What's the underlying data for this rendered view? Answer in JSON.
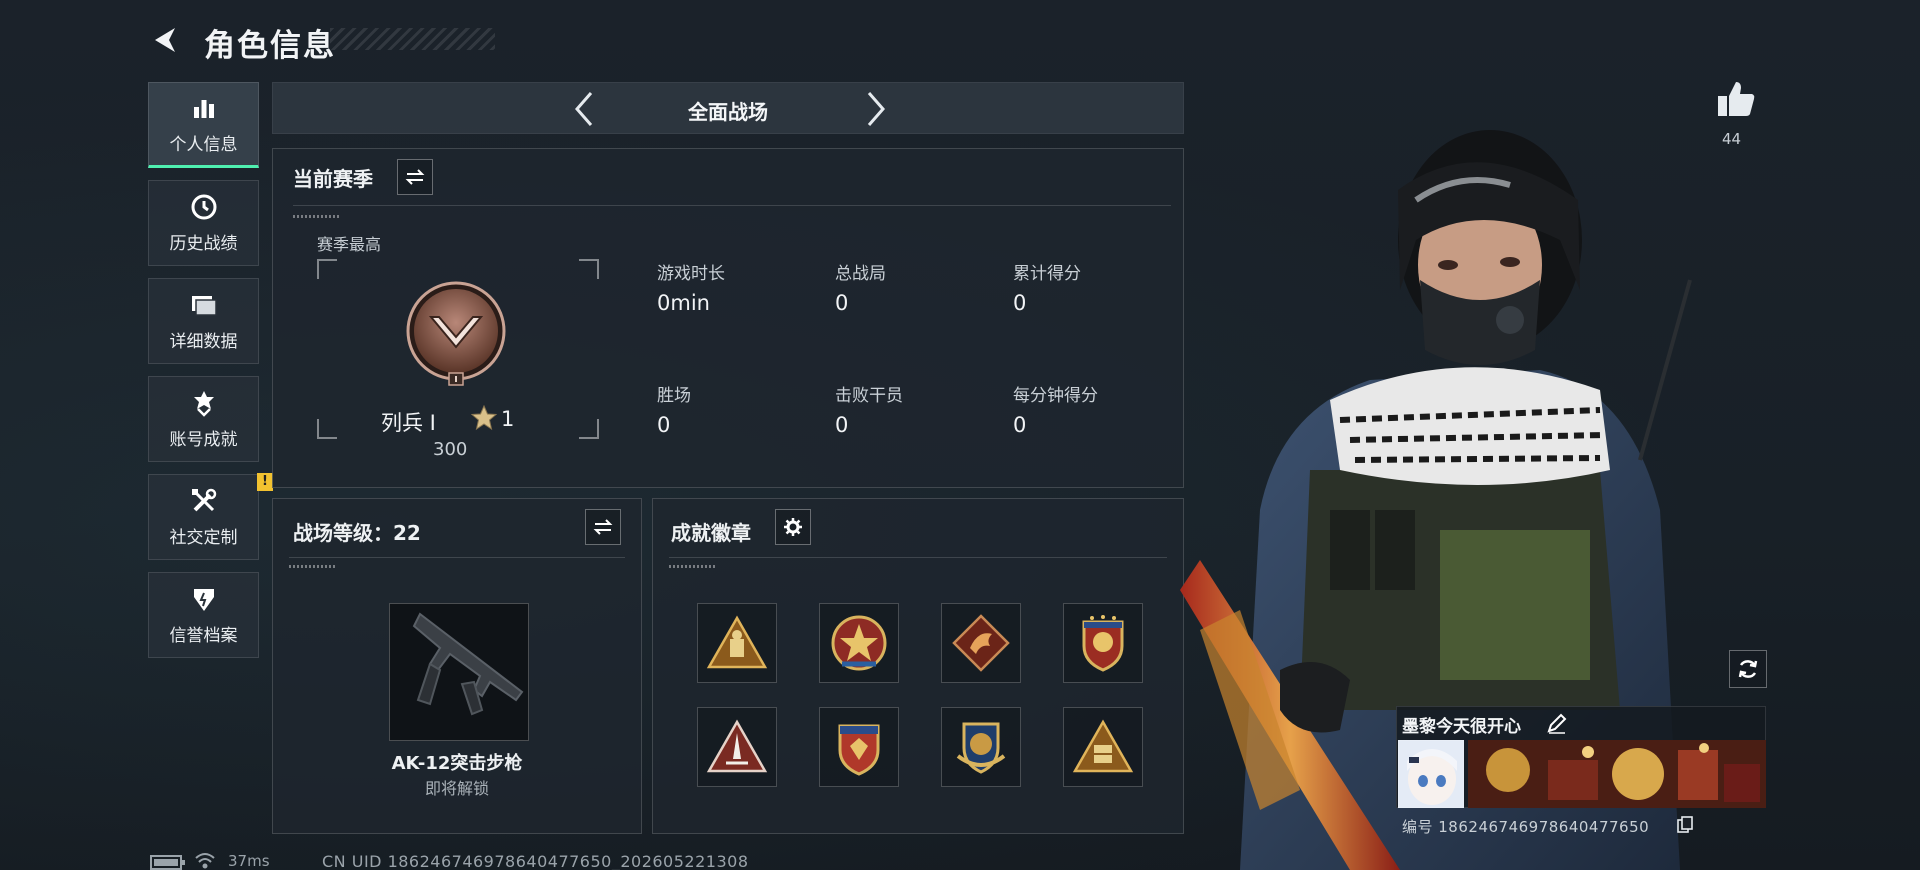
{
  "header": {
    "title": "角色信息"
  },
  "sidebar": {
    "items": [
      {
        "label": "个人信息",
        "icon": "bar-chart-icon",
        "active": true
      },
      {
        "label": "历史战绩",
        "icon": "clock-icon"
      },
      {
        "label": "详细数据",
        "icon": "folder-icon"
      },
      {
        "label": "账号成就",
        "icon": "achievement-icon"
      },
      {
        "label": "社交定制",
        "icon": "tools-icon",
        "badge": "!"
      },
      {
        "label": "信誉档案",
        "icon": "shield-icon"
      }
    ]
  },
  "mode": {
    "label": "全面战场"
  },
  "season": {
    "title": "当前赛季",
    "subtitle": "赛季最高",
    "rank_name": "列兵 I",
    "rank_stars": "1",
    "rank_score": "300",
    "stats": [
      {
        "label": "游戏时长",
        "value": "0min"
      },
      {
        "label": "总战局",
        "value": "0"
      },
      {
        "label": "累计得分",
        "value": "0"
      },
      {
        "label": "胜场",
        "value": "0"
      },
      {
        "label": "击败干员",
        "value": "0"
      },
      {
        "label": "每分钟得分",
        "value": "0"
      }
    ]
  },
  "battlefield_level": {
    "title": "战场等级：22",
    "weapon_name": "AK-12突击步枪",
    "weapon_status": "即将解锁"
  },
  "badges": {
    "title": "成就徽章",
    "count": 8
  },
  "profile": {
    "likes": "44",
    "player_name": "墨黎今天很开心",
    "player_id": "编号 1862467469786404776​50"
  },
  "footer": {
    "ping": "37ms",
    "uid": "CN UID 1862467469786404776​50_202605221308"
  },
  "colors": {
    "accent": "#4ff0b0",
    "alert": "#f2c230",
    "bronze": "#8a5a48"
  }
}
